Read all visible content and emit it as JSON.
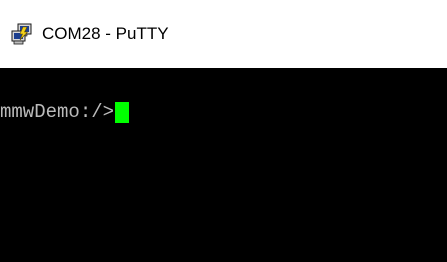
{
  "window": {
    "title": "COM28 - PuTTY",
    "icon": "putty-icon"
  },
  "terminal": {
    "prompt": "mmwDemo:/>",
    "background_color": "#000000",
    "text_color": "#bbbbbb",
    "cursor_color": "#00ff00"
  }
}
